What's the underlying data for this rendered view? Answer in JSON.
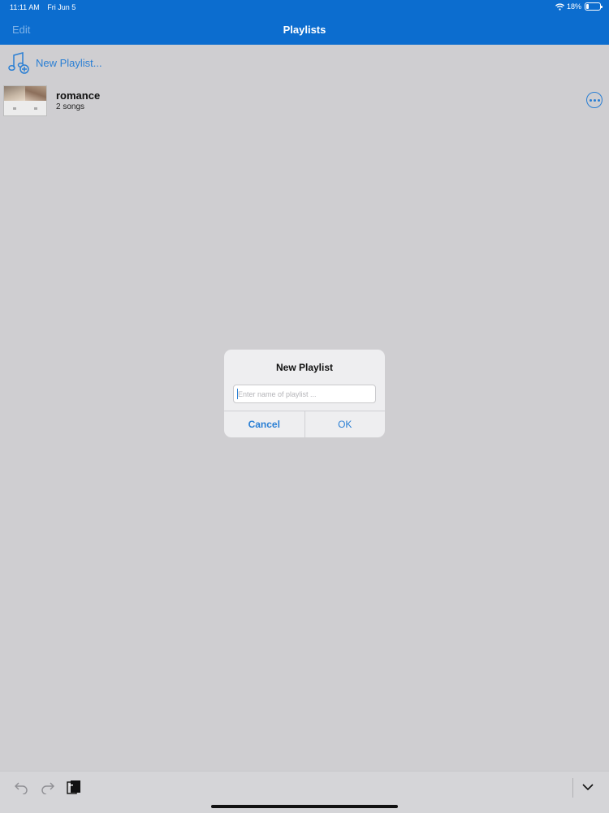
{
  "status_bar": {
    "time": "11:11 AM",
    "date": "Fri Jun 5",
    "battery": "18%",
    "battery_level": 0.18
  },
  "nav": {
    "edit_label": "Edit",
    "title": "Playlists"
  },
  "new_playlist": {
    "label": "New Playlist...",
    "icon": "music-add-icon"
  },
  "playlists": [
    {
      "name": "romance",
      "count": "2 songs"
    }
  ],
  "dialog": {
    "title": "New Playlist",
    "placeholder": "Enter name of playlist ...",
    "value": "",
    "cancel_label": "Cancel",
    "ok_label": "OK"
  },
  "toolbar": {
    "icons": [
      "undo-icon",
      "redo-icon",
      "paste-icon",
      "chevron-down-icon"
    ]
  },
  "colors": {
    "nav_bg": "#0c6dcf",
    "accent": "#2a7fd4",
    "background": "#cfced1"
  }
}
